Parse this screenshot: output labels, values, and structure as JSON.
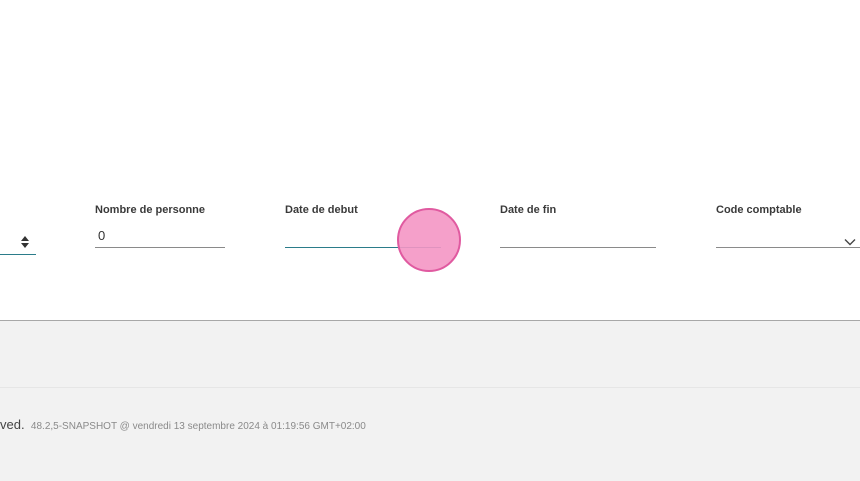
{
  "form": {
    "fields": [
      {
        "label": "Nombre de personne",
        "value": "0"
      },
      {
        "label": "Date de debut",
        "value": ""
      },
      {
        "label": "Date de fin",
        "value": ""
      },
      {
        "label": "Code comptable",
        "value": ""
      }
    ]
  },
  "footer": {
    "rights_fragment": "ved.",
    "version_info": "48.2,5-SNAPSHOT @ vendredi 13 septembre 2024 à 01:19:56 GMT+02:00"
  },
  "colors": {
    "focus_underline": "#2b7c8a",
    "cursor_highlight": "#f496c4",
    "footer_background": "#f2f2f2"
  }
}
